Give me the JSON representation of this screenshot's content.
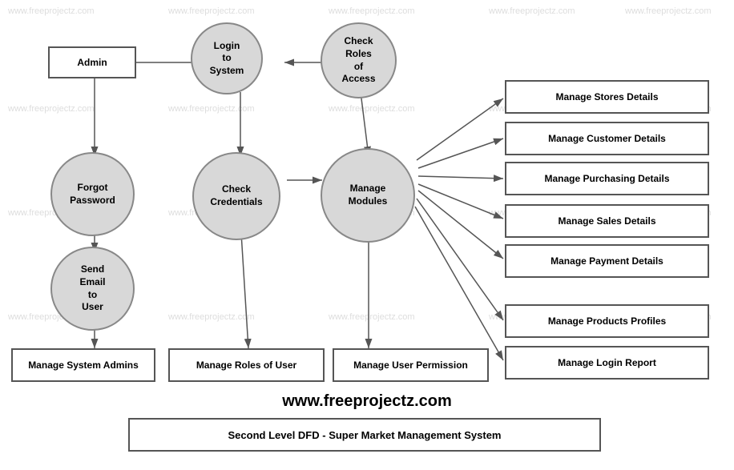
{
  "title": "Second Level DFD - Super Market Management System",
  "website": "www.freeprojectz.com",
  "nodes": {
    "admin": "Admin",
    "login": "Login\nto\nSystem",
    "checkRoles": "Check\nRoles\nof\nAccess",
    "forgotPassword": "Forgot\nPassword",
    "checkCredentials": "Check\nCredentials",
    "manageModules": "Manage\nModules",
    "sendEmail": "Send\nEmail\nto\nUser",
    "manageSystemAdmins": "Manage System Admins",
    "manageRoles": "Manage Roles of User",
    "manageUserPermission": "Manage User Permission",
    "manageStoresDetails": "Manage Stores Details",
    "manageCustomerDetails": "Manage Customer Details",
    "managePurchasingDetails": "Manage Purchasing Details",
    "manageSalesDetails": "Manage Sales Details",
    "managePaymentDetails": "Manage Payment Details",
    "manageProductsProfiles": "Manage Products Profiles",
    "manageLoginReport": "Manage Login Report"
  },
  "watermarks": [
    "www.freeprojectz.com"
  ]
}
